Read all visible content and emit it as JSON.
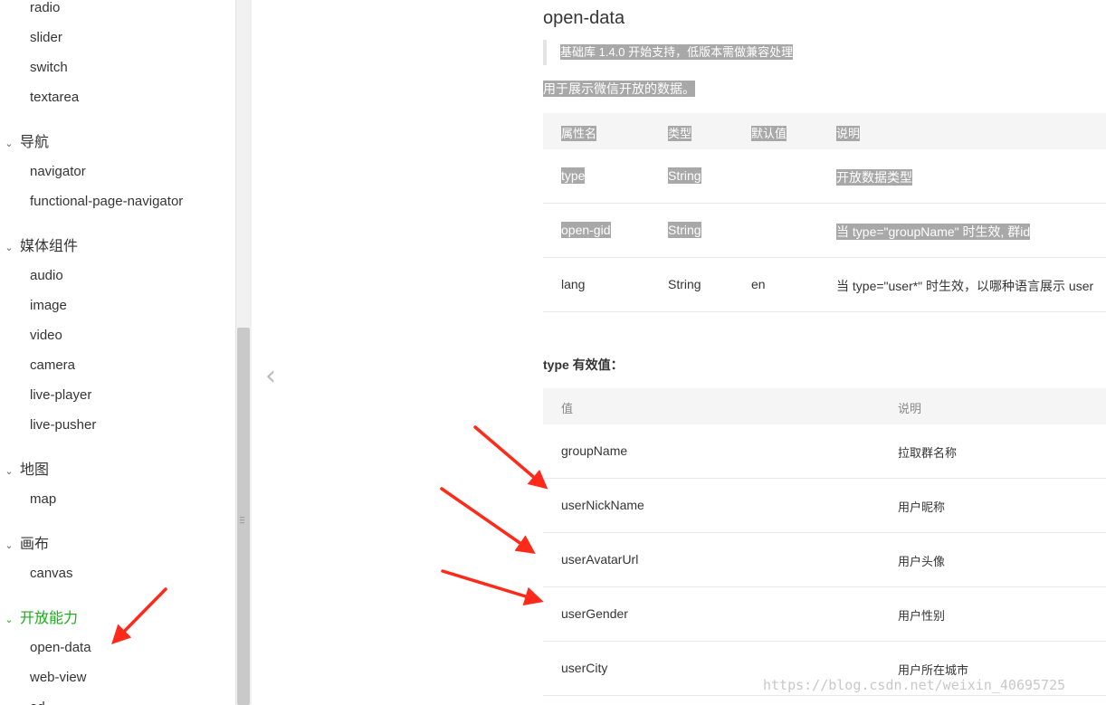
{
  "sidebar": {
    "items_top": [
      "radio",
      "slider",
      "switch",
      "textarea"
    ],
    "cat_nav": "导航",
    "nav_items": [
      "navigator",
      "functional-page-navigator"
    ],
    "cat_media": "媒体组件",
    "media_items": [
      "audio",
      "image",
      "video",
      "camera",
      "live-player",
      "live-pusher"
    ],
    "cat_map": "地图",
    "map_items": [
      "map"
    ],
    "cat_canvas": "画布",
    "canvas_items": [
      "canvas"
    ],
    "cat_open": "开放能力",
    "open_items": [
      "open-data",
      "web-view"
    ],
    "partial_item": "ad",
    "chevron": "⌄",
    "active_color": "#1aad19"
  },
  "prev_arrow": "‹",
  "content": {
    "title": "open-data",
    "note": "基础库 1.4.0 开始支持，低版本需做兼容处理",
    "description": "用于展示微信开放的数据。",
    "attr_table": {
      "headers": [
        "属性名",
        "类型",
        "默认值",
        "说明"
      ],
      "rows": [
        [
          "type",
          "String",
          "",
          "开放数据类型"
        ],
        [
          "open-gid",
          "String",
          "",
          "当 type=\"groupName\" 时生效, 群id"
        ],
        [
          "lang",
          "String",
          "en",
          "当 type=\"user*\" 时生效，以哪种语言展示 user"
        ]
      ]
    },
    "type_title": "type 有效值：",
    "type_table": {
      "headers": [
        "值",
        "说明"
      ],
      "rows": [
        [
          "groupName",
          "拉取群名称"
        ],
        [
          "userNickName",
          "用户昵称"
        ],
        [
          "userAvatarUrl",
          "用户头像"
        ],
        [
          "userGender",
          "用户性别"
        ],
        [
          "userCity",
          "用户所在城市"
        ]
      ]
    }
  },
  "watermark": "https://blog.csdn.net/weixin_40695725",
  "colors": {
    "arrow": "#ff2a1a",
    "highlight": "#a8a8a8"
  }
}
